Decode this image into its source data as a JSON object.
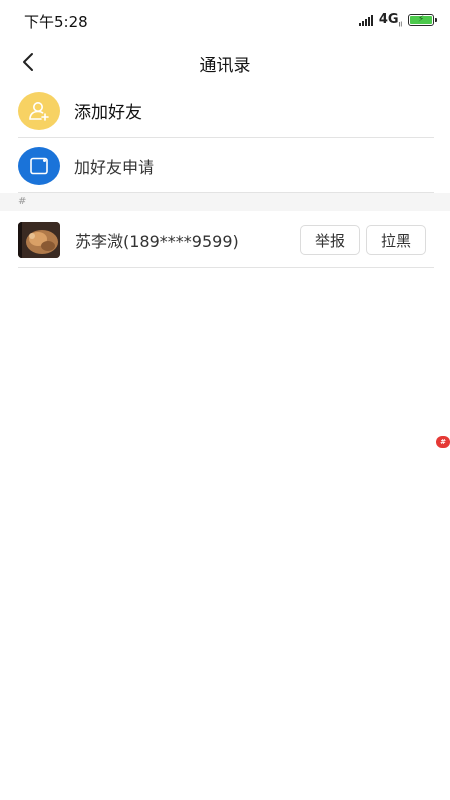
{
  "status_bar": {
    "time": "下午5:28",
    "network": "4G",
    "network_sub": "Il",
    "battery_color": "#4cc94c"
  },
  "nav": {
    "title": "通讯录",
    "back_icon": "chevron-left-icon"
  },
  "menu": {
    "add_friend": {
      "label": "添加好友",
      "icon": "add-user-icon",
      "color": "#f7d263"
    },
    "friend_requests": {
      "label": "加好友申请",
      "icon": "request-icon",
      "color": "#1a73d9"
    }
  },
  "contacts": {
    "section_letter": "#",
    "items": [
      {
        "name": "苏李溦(189****9599)",
        "actions": {
          "report": "举报",
          "block": "拉黑"
        }
      }
    ]
  },
  "floating_index": {
    "letter": "#",
    "color": "#e53935"
  }
}
